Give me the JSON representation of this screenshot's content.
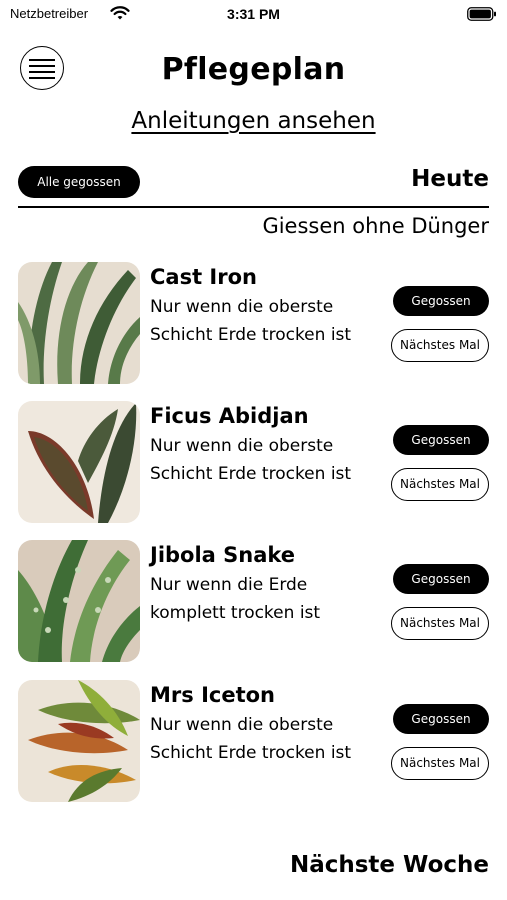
{
  "status_bar": {
    "carrier": "Netzbetreiber",
    "time": "3:31 PM"
  },
  "header": {
    "title": "Pflegeplan",
    "guides_link": "Anleitungen ansehen"
  },
  "today": {
    "all_watered_label": "Alle gegossen",
    "section_title": "Heute",
    "subheading": "Giessen ohne Dünger",
    "watered_label": "Gegossen",
    "next_time_label": "Nächstes Mal",
    "plants": [
      {
        "name": "Cast Iron",
        "line1": "Nur wenn die oberste",
        "line2": "Schicht Erde trocken ist"
      },
      {
        "name": "Ficus Abidjan",
        "line1": "Nur wenn die oberste",
        "line2": "Schicht Erde trocken ist"
      },
      {
        "name": "Jibola Snake",
        "line1": "Nur wenn die Erde",
        "line2": "komplett trocken ist"
      },
      {
        "name": "Mrs Iceton",
        "line1": "Nur wenn die oberste",
        "line2": "Schicht Erde trocken ist"
      }
    ]
  },
  "next_week": {
    "section_title": "Nächste Woche"
  },
  "icons": {
    "menu": "hamburger-menu-icon",
    "wifi": "wifi-icon",
    "battery": "battery-icon"
  }
}
